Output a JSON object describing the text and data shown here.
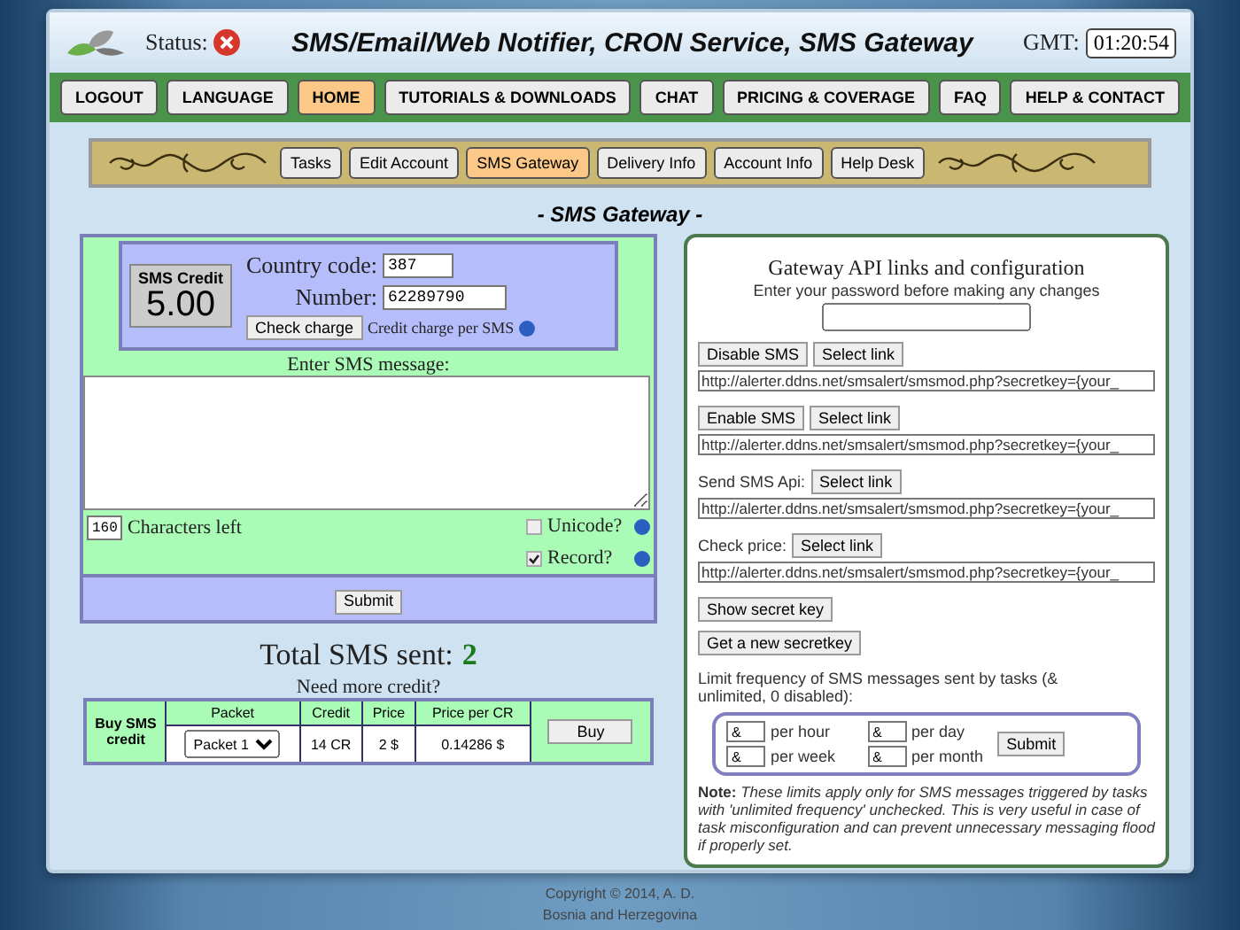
{
  "header": {
    "status_label": "Status:",
    "status_ok": false,
    "title": "SMS/Email/Web Notifier, CRON Service, SMS Gateway",
    "gmt_label": "GMT:",
    "clock": "01:20:54"
  },
  "nav": [
    {
      "label": "LOGOUT",
      "selected": false
    },
    {
      "label": "LANGUAGE",
      "selected": false
    },
    {
      "label": "HOME",
      "selected": true
    },
    {
      "label": "TUTORIALS & DOWNLOADS",
      "selected": false
    },
    {
      "label": "CHAT",
      "selected": false
    },
    {
      "label": "PRICING & COVERAGE",
      "selected": false
    },
    {
      "label": "FAQ",
      "selected": false
    },
    {
      "label": "HELP & CONTACT",
      "selected": false
    }
  ],
  "subnav": [
    {
      "label": "Tasks",
      "selected": false
    },
    {
      "label": "Edit Account",
      "selected": false
    },
    {
      "label": "SMS Gateway",
      "selected": true
    },
    {
      "label": "Delivery Info",
      "selected": false
    },
    {
      "label": "Account Info",
      "selected": false
    },
    {
      "label": "Help Desk",
      "selected": false
    }
  ],
  "section_title": "- SMS Gateway -",
  "sms_form": {
    "credit_label": "SMS Credit",
    "credit_value": "5.00",
    "country_code_label": "Country code:",
    "country_code": "387",
    "number_label": "Number:",
    "number": "62289790",
    "check_charge": "Check charge",
    "charge_note": "Credit charge per SMS",
    "message_label": "Enter SMS message:",
    "chars_left": "160",
    "chars_left_label": "Characters left",
    "options": [
      {
        "label": "Unicode?",
        "checked": false
      },
      {
        "label": "Record?",
        "checked": true
      }
    ],
    "submit": "Submit"
  },
  "total": {
    "label": "Total SMS sent:",
    "value": "2"
  },
  "need_credit": "Need more credit?",
  "buy_table": {
    "heading": "Buy SMS credit",
    "columns": [
      "Packet",
      "Credit",
      "Price",
      "Price per CR"
    ],
    "packet": "Packet 1",
    "credit": "14 CR",
    "price": "2 $",
    "price_per_cr": "0.14286 $",
    "buy": "Buy"
  },
  "api": {
    "title": "Gateway API links and configuration",
    "password_hint": "Enter your password before making any changes",
    "links": [
      {
        "kind": "button",
        "label": "Disable SMS",
        "select": "Select link",
        "url": "http://alerter.ddns.net/smsalert/smsmod.php?secretkey={your_"
      },
      {
        "kind": "button",
        "label": "Enable SMS",
        "select": "Select link",
        "url": "http://alerter.ddns.net/smsalert/smsmod.php?secretkey={your_"
      },
      {
        "kind": "text",
        "label": "Send SMS Api:",
        "select": "Select link",
        "url": "http://alerter.ddns.net/smsalert/smsmod.php?secretkey={your_"
      },
      {
        "kind": "text",
        "label": "Check price:",
        "select": "Select link",
        "url": "http://alerter.ddns.net/smsalert/smsmod.php?secretkey={your_"
      }
    ],
    "show_key": "Show secret key",
    "new_key": "Get a new secretkey",
    "limit_text": "Limit frequency of SMS messages sent by tasks (& unlimited, 0 disabled):",
    "limits": [
      {
        "value": "&",
        "label": "per hour"
      },
      {
        "value": "&",
        "label": "per day"
      },
      {
        "value": "&",
        "label": "per week"
      },
      {
        "value": "&",
        "label": "per month"
      }
    ],
    "limit_submit": "Submit",
    "note": "**Note:** *These limits apply only for SMS messages triggered by tasks with 'unlimited frequency' unchecked. This is very useful in case of task misconfiguration and can prevent unnecessary messaging flood if properly set.*"
  },
  "footer": [
    "Copyright © 2014, A. D.",
    "Bosnia and Herzegovina"
  ]
}
